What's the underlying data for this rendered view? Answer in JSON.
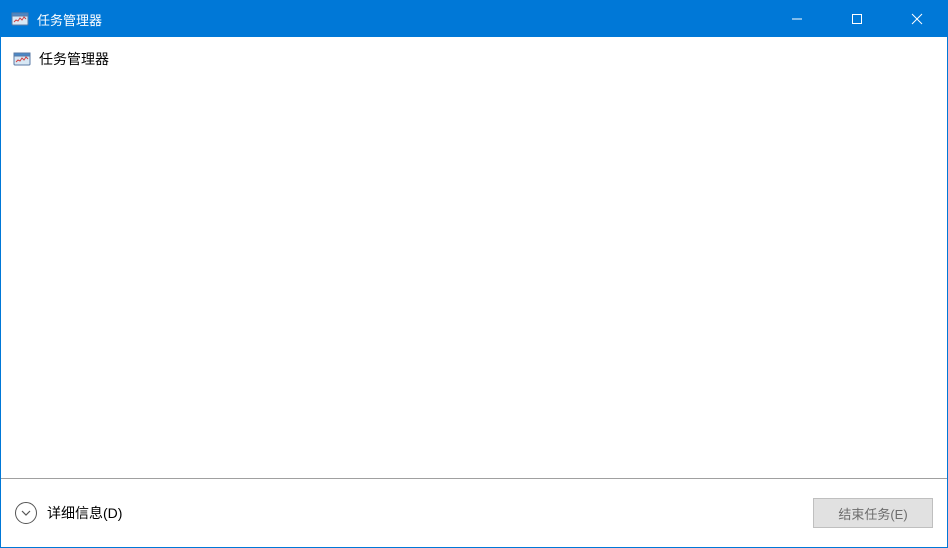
{
  "titlebar": {
    "title": "任务管理器"
  },
  "processes": [
    {
      "name": "任务管理器"
    }
  ],
  "footer": {
    "details_label": "详细信息(D)",
    "end_task_label": "结束任务(E)"
  }
}
